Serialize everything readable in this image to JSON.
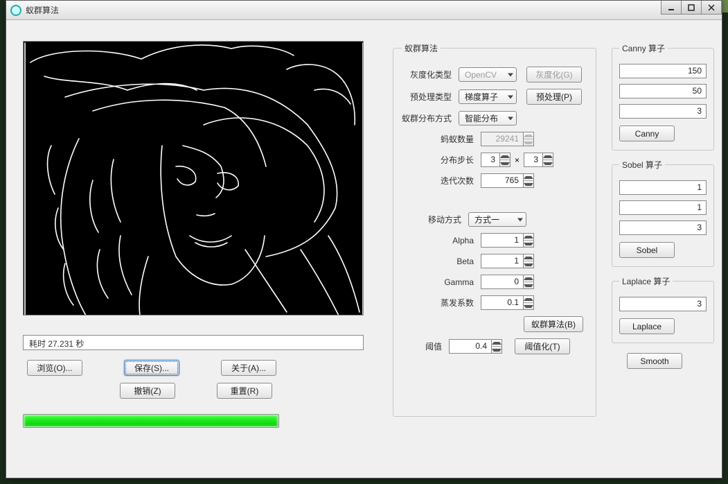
{
  "window": {
    "title": "蚁群算法"
  },
  "status_text": "耗时 27.231 秒",
  "buttons": {
    "browse": "浏览(O)...",
    "save": "保存(S)...",
    "about": "关于(A)...",
    "undo": "撤销(Z)",
    "reset": "重置(R)"
  },
  "mid": {
    "legend": "蚁群算法",
    "gray_type_label": "灰度化类型",
    "gray_type_value": "OpenCV",
    "gray_btn": "灰度化(G)",
    "pre_type_label": "预处理类型",
    "pre_type_value": "梯度算子",
    "pre_btn": "预处理(P)",
    "dist_label": "蚁群分布方式",
    "dist_value": "智能分布",
    "ant_count_label": "蚂蚁数量",
    "ant_count_value": "29241",
    "step_label": "分布步长",
    "step_x": "3",
    "step_y": "3",
    "iter_label": "迭代次数",
    "iter_value": "765",
    "move_label": "移动方式",
    "move_value": "方式一",
    "alpha_label": "Alpha",
    "alpha_value": "1",
    "beta_label": "Beta",
    "beta_value": "1",
    "gamma_label": "Gamma",
    "gamma_value": "0",
    "evap_label": "蒸发系数",
    "evap_value": "0.1",
    "run_btn": "蚁群算法(B)",
    "thresh_label": "阈值",
    "thresh_value": "0.4",
    "thresh_btn": "阈值化(T)"
  },
  "canny": {
    "legend": "Canny 算子",
    "v1": "150",
    "v2": "50",
    "v3": "3",
    "btn": "Canny"
  },
  "sobel": {
    "legend": "Sobel 算子",
    "v1": "1",
    "v2": "1",
    "v3": "3",
    "btn": "Sobel"
  },
  "laplace": {
    "legend": "Laplace 算子",
    "v1": "3",
    "btn": "Laplace"
  },
  "smooth_btn": "Smooth"
}
